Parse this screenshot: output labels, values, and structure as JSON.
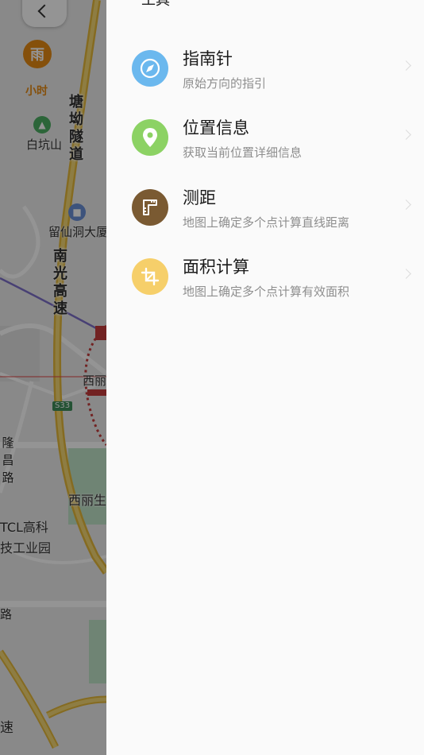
{
  "map": {
    "weather_label": "小时",
    "weather_glyph": "雨",
    "labels": {
      "baikengshan": "白坑山",
      "liuxiandong": "留仙洞大厦",
      "tcl_line1": "TCL高科",
      "tcl_line2": "技工业园",
      "xili": "西丽生",
      "xili_small": "西丽",
      "highway_sign": "S33",
      "tanggao_tunnel": "塘坳隧道",
      "nanguang_highway": "南光高速",
      "longchang": "隆昌路",
      "lu": "路",
      "su": "速"
    }
  },
  "drawer": {
    "title": "工具",
    "items": [
      {
        "title": "指南针",
        "subtitle": "原始方向的指引",
        "color": "#6bb8ee",
        "icon": "compass-icon"
      },
      {
        "title": "位置信息",
        "subtitle": "获取当前位置详细信息",
        "color": "#8cd264",
        "icon": "location-pin-icon"
      },
      {
        "title": "测距",
        "subtitle": "地图上确定多个点计算直线距离",
        "color": "#7a5a32",
        "icon": "ruler-icon"
      },
      {
        "title": "面积计算",
        "subtitle": "地图上确定多个点计算有效面积",
        "color": "#f6cf6a",
        "icon": "crop-icon"
      }
    ]
  }
}
